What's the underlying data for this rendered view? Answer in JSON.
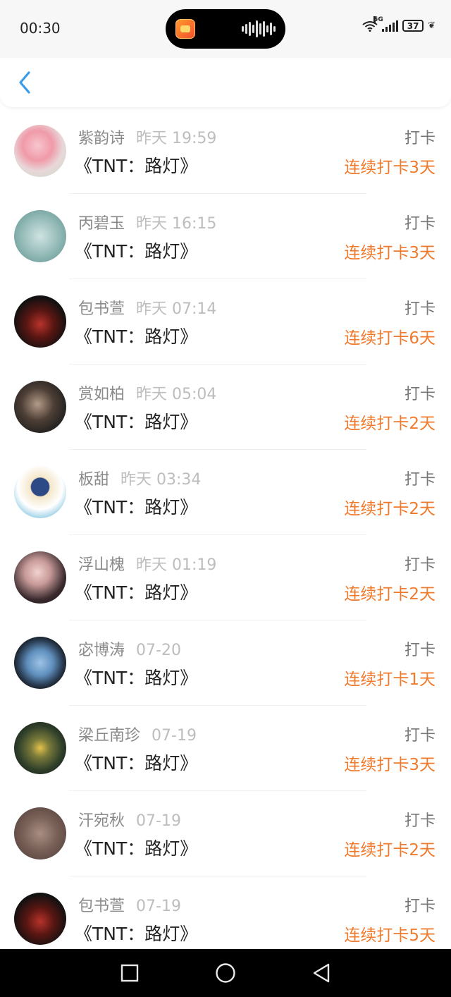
{
  "status_bar": {
    "time": "00:30",
    "network": "5G",
    "battery": "37"
  },
  "nav": {
    "back_icon": "chevron-left-icon"
  },
  "colors": {
    "accent": "#3a9be8",
    "streak": "#f07a2c",
    "name": "#8a8a8a",
    "timestamp": "#bdbdbd"
  },
  "checkins": [
    {
      "user": "紫韵诗",
      "time": "昨天 19:59",
      "book": "《TNT：路灯》",
      "action": "打卡",
      "streak": "连续打卡3天"
    },
    {
      "user": "丙碧玉",
      "time": "昨天 16:15",
      "book": "《TNT：路灯》",
      "action": "打卡",
      "streak": "连续打卡3天"
    },
    {
      "user": "包书萱",
      "time": "昨天 07:14",
      "book": "《TNT：路灯》",
      "action": "打卡",
      "streak": "连续打卡6天"
    },
    {
      "user": "赏如柏",
      "time": "昨天 05:04",
      "book": "《TNT：路灯》",
      "action": "打卡",
      "streak": "连续打卡2天"
    },
    {
      "user": "板甜",
      "time": "昨天 03:34",
      "book": "《TNT：路灯》",
      "action": "打卡",
      "streak": "连续打卡2天"
    },
    {
      "user": "浮山槐",
      "time": "昨天 01:19",
      "book": "《TNT：路灯》",
      "action": "打卡",
      "streak": "连续打卡2天"
    },
    {
      "user": "宓博涛",
      "time": "07-20",
      "book": "《TNT：路灯》",
      "action": "打卡",
      "streak": "连续打卡1天"
    },
    {
      "user": "梁丘南珍",
      "time": "07-19",
      "book": "《TNT：路灯》",
      "action": "打卡",
      "streak": "连续打卡3天"
    },
    {
      "user": "汗宛秋",
      "time": "07-19",
      "book": "《TNT：路灯》",
      "action": "打卡",
      "streak": "连续打卡2天"
    },
    {
      "user": "包书萱",
      "time": "07-19",
      "book": "《TNT：路灯》",
      "action": "打卡",
      "streak": "连续打卡5天"
    }
  ],
  "system_nav": {
    "recent": "square-icon",
    "home": "circle-icon",
    "back": "triangle-back-icon"
  }
}
